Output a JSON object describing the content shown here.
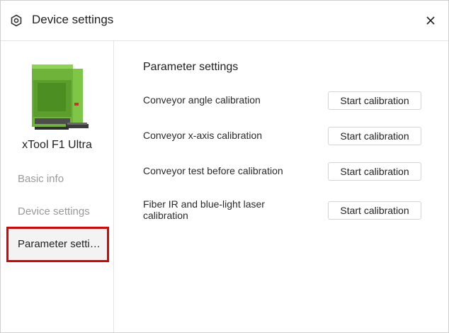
{
  "header": {
    "title": "Device settings",
    "icon": "hexagon-settings-icon",
    "close_icon": "close-icon"
  },
  "sidebar": {
    "device_name": "xTool F1 Ultra",
    "items": [
      {
        "label": "Basic info",
        "active": false
      },
      {
        "label": "Device settings",
        "active": false
      },
      {
        "label": "Parameter settings",
        "active": true
      }
    ],
    "highlight_color": "#e00000"
  },
  "main": {
    "title": "Parameter settings",
    "rows": [
      {
        "label": "Conveyor angle calibration",
        "button": "Start calibration"
      },
      {
        "label": "Conveyor x-axis calibration",
        "button": "Start calibration"
      },
      {
        "label": "Conveyor test before calibration",
        "button": "Start calibration"
      },
      {
        "label": "Fiber IR and blue-light laser calibration",
        "button": "Start calibration"
      }
    ]
  },
  "colors": {
    "device_green": "#7cc143",
    "device_gray": "#5a5a5a"
  }
}
